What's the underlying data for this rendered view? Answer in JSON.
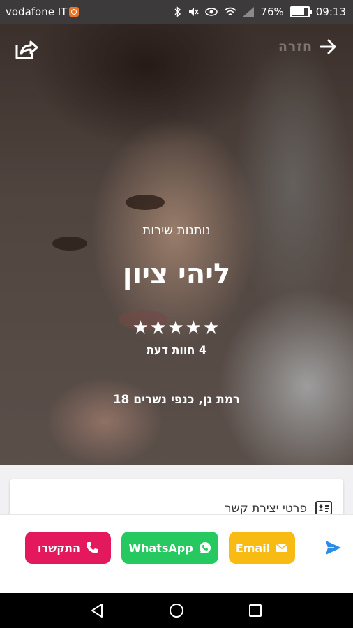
{
  "status_bar": {
    "carrier": "vodafone IT",
    "battery": "76%",
    "time": "09:13"
  },
  "header": {
    "back_label": "חזרה"
  },
  "profile": {
    "role": "נותנות שירות",
    "name": "ליהי ציון",
    "rating_stars": "★★★★★",
    "rating_value": 5,
    "reviews": "4 חוות דעת",
    "address": "רמת גן, כנפי נשרים 18"
  },
  "contact_card": {
    "title": "פרטי יצירת קשר"
  },
  "actions": {
    "call_label": "התקשרו",
    "whatsapp_label": "WhatsApp",
    "email_label": "Email"
  },
  "colors": {
    "call": "#e4195d",
    "whatsapp": "#25c960",
    "email": "#f7bb13",
    "send": "#2d8de6"
  },
  "icons": [
    "share-icon",
    "back-arrow-icon",
    "contact-card-icon",
    "phone-icon",
    "whatsapp-icon",
    "mail-icon",
    "send-icon",
    "nav-back-icon",
    "nav-home-icon",
    "nav-recent-icon"
  ]
}
